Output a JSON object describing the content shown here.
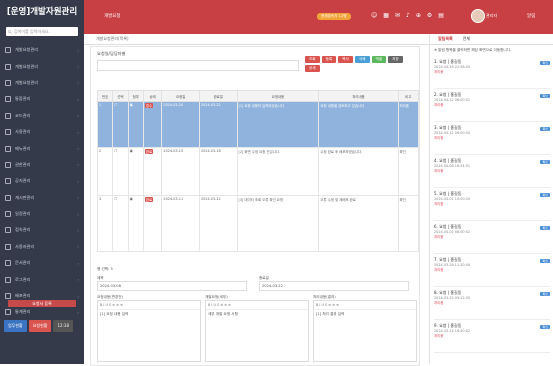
{
  "brand": "[운영]개발자원관리",
  "search": {
    "placeholder": "검색어를 입력하세요."
  },
  "nav": [
    {
      "label": "개발요청관리"
    },
    {
      "label": "개발요청관리"
    },
    {
      "label": "개발요청관리"
    },
    {
      "label": "통합관리"
    },
    {
      "label": "코드관리"
    },
    {
      "label": "사용관리"
    },
    {
      "label": "메뉴관리"
    },
    {
      "label": "권한관리"
    },
    {
      "label": "공지관리"
    },
    {
      "label": "게시판관리"
    },
    {
      "label": "일정관리"
    },
    {
      "label": "접속관리"
    },
    {
      "label": "사용자관리"
    },
    {
      "label": "문서관리"
    },
    {
      "label": "로그관리"
    },
    {
      "label": "배포관리"
    },
    {
      "label": "통계관리"
    }
  ],
  "sb_button": "요청서 등록",
  "sb_footer": [
    "업무현황",
    "요청현황",
    "12:38"
  ],
  "topbar": {
    "app": "개발요청",
    "pill": "현재접속자 12명",
    "user": "관리자",
    "right_title": "알림"
  },
  "main": {
    "tab": "개발요청관리(목록)",
    "panel_title": "요청일/담당자별",
    "buttons": [
      {
        "label": "조회",
        "color": "#d9534f"
      },
      {
        "label": "등록",
        "color": "#d9534f"
      },
      {
        "label": "복사",
        "color": "#d9534f"
      },
      {
        "label": "삭제",
        "color": "#4aa0d6"
      },
      {
        "label": "엑셀",
        "color": "#5cb85c"
      },
      {
        "label": "저장",
        "color": "#666"
      },
      {
        "label": "상세",
        "color": "#d9534f"
      }
    ],
    "headers": [
      "번호",
      "선택",
      "첨부",
      "상태",
      "요청일",
      "완료일",
      "요청내용",
      "처리내용",
      "비고"
    ],
    "rows": [
      {
        "no": "1",
        "status": "접수",
        "date": "2024-03-20",
        "done": "2024-03-22",
        "req": "[1] 요청 내용이 입력되었습니다.",
        "res": "요청 내용을 검토하고 있습니다.",
        "note": "처리중"
      },
      {
        "no": "2",
        "status": "완료",
        "date": "2024-03-15",
        "done": "2024-03-18",
        "req": "[2] 화면 수정 요청 건입니다.",
        "res": "수정 완료 후 배포하였습니다.",
        "note": "확인"
      },
      {
        "no": "3",
        "status": "완료",
        "date": "2024-03-11",
        "done": "2024-03-12",
        "req": "[3] 데이터 조회 오류 확인 요청",
        "res": "오류 수정 및 재배포 완료",
        "note": "확인"
      }
    ],
    "pager_label": "행 선택: 3",
    "form": {
      "title_label": "제목",
      "title_value": "2024-03-08",
      "date_label": "종료일",
      "date_value": "2024-03-22",
      "ed1_label": "요청내용(변경전)",
      "ed2_label": "개발요청(세부)",
      "ed3_label": "처리내용(결과)",
      "ed1_text": "[1] 요청 내용 입력",
      "ed2_text": "세부 개발 요청 사항",
      "ed3_text": "[1] 처리 결과 입력",
      "toolbar": "B I U S ≡ ≡ ≡"
    }
  },
  "right": {
    "tabs": [
      "알림목록",
      "전체"
    ],
    "note": "※ 알림 항목을 클릭하면 해당 화면으로 이동합니다.",
    "items": [
      {
        "t": "1. 요청 | 홍길동",
        "d": "2024-04-16 22:58:04",
        "r": "처리중",
        "badge": "확인"
      },
      {
        "t": "2. 요청 | 홍길동",
        "d": "2024-04-12 08:00:51",
        "r": "처리중",
        "badge": "확인"
      },
      {
        "t": "3. 요청 | 홍길동",
        "d": "2024-04-12 08:00:50",
        "r": "처리중",
        "badge": "확인"
      },
      {
        "t": "4. 요청 | 홍길동",
        "d": "2024-04-08 18:54:51",
        "r": "처리중",
        "badge": "확인"
      },
      {
        "t": "5. 요청 | 홍길동",
        "d": "2024-04-01 10:00:20",
        "r": "처리중",
        "badge": "확인"
      },
      {
        "t": "6. 요청 | 홍길동",
        "d": "2024-04-01 08:00:02",
        "r": "처리중",
        "badge": "확인"
      },
      {
        "t": "7. 요청 | 홍길동",
        "d": "2024-03-28 11:20:44",
        "r": "처리중",
        "badge": "확인"
      },
      {
        "t": "8. 요청 | 홍길동",
        "d": "2024-03-25 09:12:30",
        "r": "처리중",
        "badge": "확인"
      },
      {
        "t": "9. 요청 | 홍길동",
        "d": "2024-03-22 16:40:02",
        "r": "처리중",
        "badge": "확인"
      }
    ]
  }
}
